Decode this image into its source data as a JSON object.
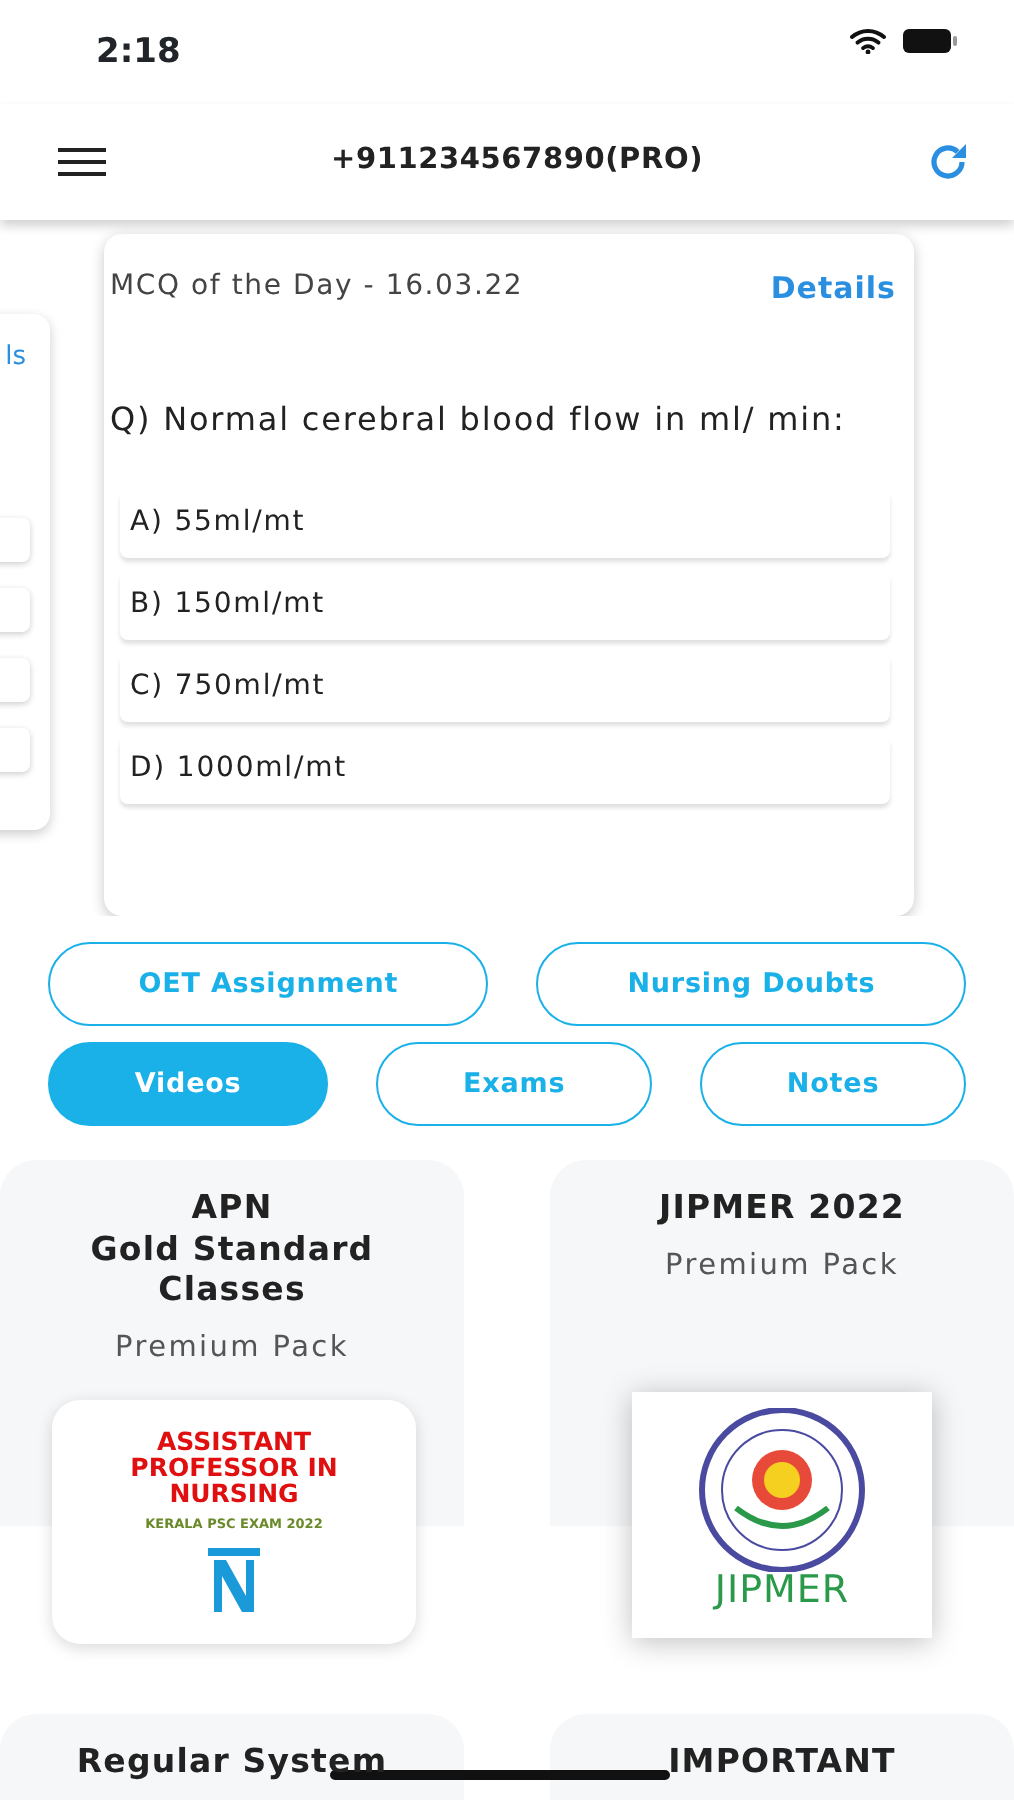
{
  "status_bar": {
    "time": "2:18"
  },
  "header": {
    "title": "+911234567890(PRO)"
  },
  "mcq_carousel": [
    {
      "kind": "peek",
      "details": "ls"
    },
    {
      "kind": "main",
      "title": "MCQ of the Day - 16.03.22",
      "details": "Details",
      "question": "Q) Normal cerebral blood flow in ml/ min:",
      "options": [
        "A) 55ml/mt",
        "B) 150ml/mt",
        "C) 750ml/mt",
        "D) 1000ml/mt"
      ]
    }
  ],
  "links": [
    [
      {
        "label": "OET Assignment",
        "selected": false
      },
      {
        "label": "Nursing Doubts",
        "selected": false
      }
    ],
    [
      {
        "label": "Videos",
        "selected": true
      },
      {
        "label": "Exams",
        "selected": false
      },
      {
        "label": "Notes",
        "selected": false
      }
    ]
  ],
  "courses": [
    {
      "title": "APN\nGold Standard\nClasses",
      "subtitle": "Premium Pack",
      "image": {
        "kind": "poster",
        "heading": "ASSISTANT PROFESSOR IN NURSING",
        "caption": "KERALA PSC EXAM 2022"
      }
    },
    {
      "title": "JIPMER 2022",
      "subtitle": "Premium Pack",
      "image": {
        "kind": "seal",
        "caption": "JIPMER"
      }
    },
    {
      "title": "Regular System"
    },
    {
      "title": "IMPORTANT"
    }
  ]
}
